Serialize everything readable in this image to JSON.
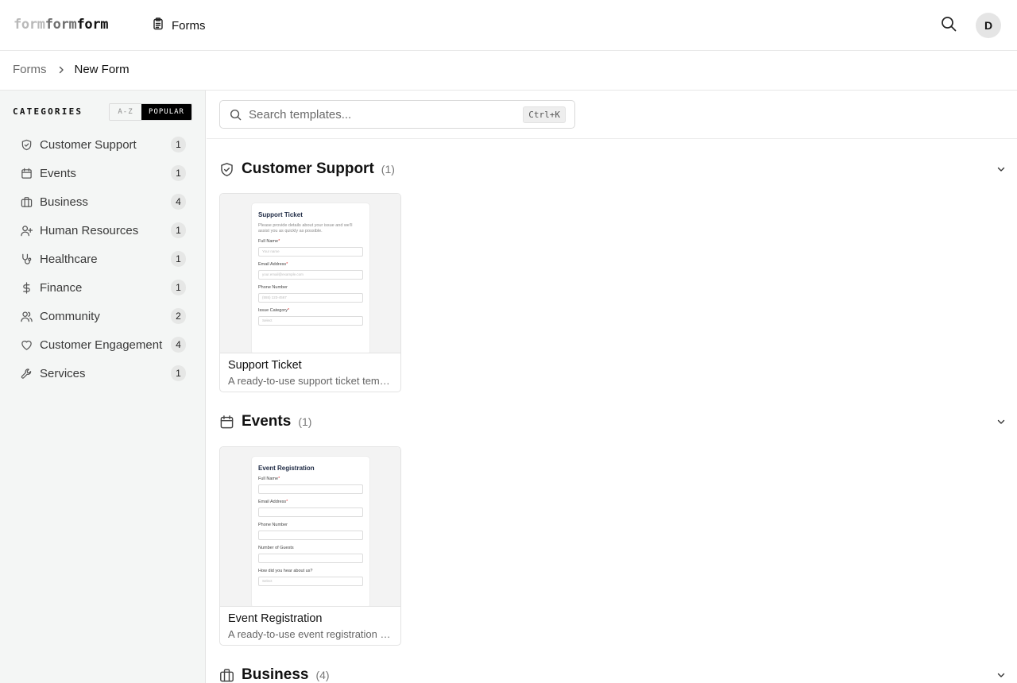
{
  "app": {
    "logo_parts": [
      "form",
      "form",
      "form"
    ],
    "nav_forms_label": "Forms",
    "avatar_initial": "D"
  },
  "breadcrumb": {
    "root": "Forms",
    "current": "New Form"
  },
  "sidebar": {
    "title": "CATEGORIES",
    "sort_az": "A-Z",
    "sort_popular": "POPULAR",
    "active_sort": "POPULAR",
    "items": [
      {
        "label": "Customer Support",
        "count": "1",
        "icon": "shield-check-icon"
      },
      {
        "label": "Events",
        "count": "1",
        "icon": "calendar-icon"
      },
      {
        "label": "Business",
        "count": "4",
        "icon": "briefcase-icon"
      },
      {
        "label": "Human Resources",
        "count": "1",
        "icon": "user-plus-icon"
      },
      {
        "label": "Healthcare",
        "count": "1",
        "icon": "stethoscope-icon"
      },
      {
        "label": "Finance",
        "count": "1",
        "icon": "dollar-icon"
      },
      {
        "label": "Community",
        "count": "2",
        "icon": "users-icon"
      },
      {
        "label": "Customer Engagement",
        "count": "4",
        "icon": "heart-icon"
      },
      {
        "label": "Services",
        "count": "1",
        "icon": "wrench-icon"
      }
    ]
  },
  "search": {
    "placeholder": "Search templates...",
    "shortcut": "Ctrl+K"
  },
  "sections": [
    {
      "title": "Customer Support",
      "count": "(1)",
      "icon": "shield-check-icon",
      "cards": [
        {
          "name": "Support Ticket",
          "description": "A ready-to-use support ticket template",
          "preview": {
            "title": "Support Ticket",
            "description": "Please provide details about your issue and we'll assist you as quickly as possible.",
            "fields": [
              {
                "label": "Full Name",
                "required": "*",
                "placeholder": "Your name"
              },
              {
                "label": "Email Address",
                "required": "*",
                "placeholder": "your.email@example.com"
              },
              {
                "label": "Phone Number",
                "required": "",
                "placeholder": "(555) 123-4567"
              },
              {
                "label": "Issue Category",
                "required": "*",
                "placeholder": "Select"
              }
            ]
          }
        }
      ]
    },
    {
      "title": "Events",
      "count": "(1)",
      "icon": "calendar-icon",
      "cards": [
        {
          "name": "Event Registration",
          "description": "A ready-to-use event registration template",
          "preview": {
            "title": "Event Registration",
            "fields": [
              {
                "label": "Full Name",
                "required": "*",
                "placeholder": ""
              },
              {
                "label": "Email Address",
                "required": "*",
                "placeholder": ""
              },
              {
                "label": "Phone Number",
                "required": "",
                "placeholder": ""
              },
              {
                "label": "Number of Guests",
                "required": "",
                "placeholder": ""
              },
              {
                "label": "How did you hear about us?",
                "required": "",
                "placeholder": "Select"
              }
            ]
          }
        }
      ]
    },
    {
      "title": "Business",
      "count": "(4)",
      "icon": "briefcase-icon",
      "cards": []
    }
  ]
}
